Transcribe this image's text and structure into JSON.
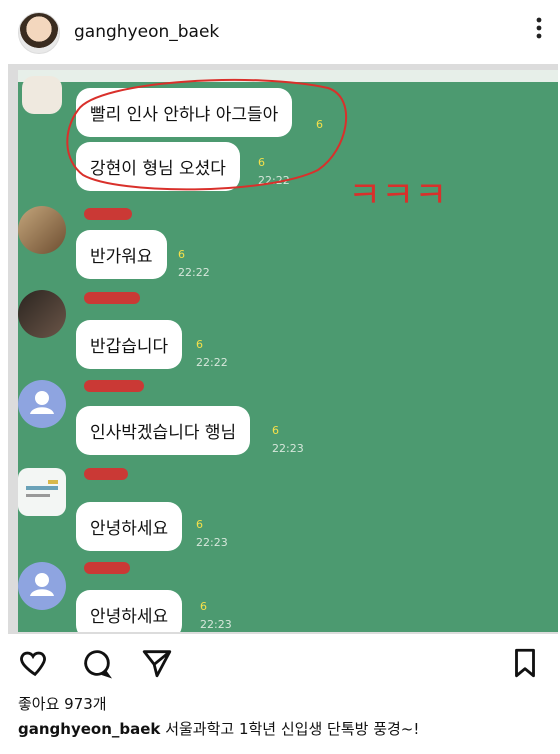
{
  "header": {
    "username": "ganghyeon_baek",
    "more_icon": "more-vertical-icon"
  },
  "chat": {
    "messages": [
      {
        "text": "빨리 인사 안하냐 아그들아",
        "count": "6",
        "time": ""
      },
      {
        "text": "강현이 형님 오셨다",
        "count": "6",
        "time": "22:22"
      },
      {
        "text": "반가워요",
        "count": "6",
        "time": "22:22"
      },
      {
        "text": "반갑습니다",
        "count": "6",
        "time": "22:22"
      },
      {
        "text": "인사박겠습니다 행님",
        "count": "6",
        "time": "22:23"
      },
      {
        "text": "안녕하세요",
        "count": "6",
        "time": "22:23"
      },
      {
        "text": "안녕하세요",
        "count": "6",
        "time": "22:23"
      }
    ],
    "annotation": "ㅋㅋㅋ",
    "colors": {
      "background": "#4c9a70",
      "annotation": "#d9302b"
    }
  },
  "actions": {
    "like_icon": "heart-icon",
    "comment_icon": "comment-icon",
    "share_icon": "send-icon",
    "save_icon": "bookmark-icon"
  },
  "likes": {
    "text": "좋아요 973개"
  },
  "caption": {
    "username": "ganghyeon_baek",
    "text": "서울과학고 1학년 신입생 단톡방 풍경~!"
  }
}
